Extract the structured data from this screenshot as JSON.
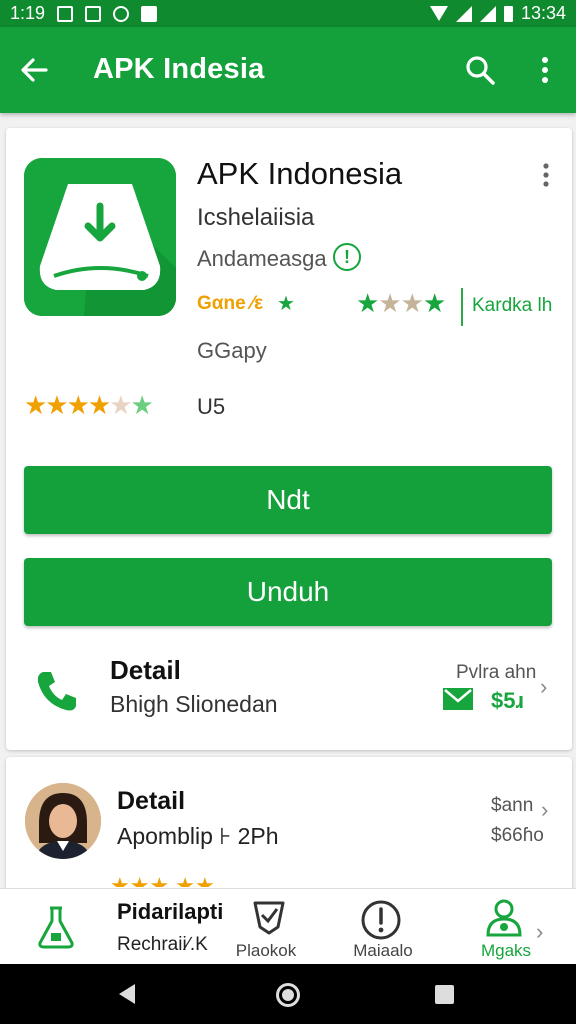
{
  "status_bar": {
    "time": "1:19",
    "clock_right": "13:34",
    "icons": [
      "image-icon",
      "mail-icon",
      "alarm-icon",
      "shield-icon",
      "wifi-icon",
      "signal-icon",
      "signal-icon",
      "battery-icon"
    ]
  },
  "app_bar": {
    "title": "APK Indesia",
    "back_icon": "back-arrow-icon",
    "search_icon": "search-icon",
    "more_icon": "more-vert-icon"
  },
  "app_card": {
    "name": "APK Indonesia",
    "subtitle": "Icshelaiisia",
    "developer": "Andameasga",
    "badge_label": "Gαne ⁄ε",
    "right_label": "Kardka lh",
    "category": "GGapy",
    "rating_count": "U5",
    "rating": 4.5,
    "primary_button": "Ndt",
    "secondary_button": "Unduh",
    "detail": {
      "title": "Detail",
      "subtitle": "Bhigh Slionedan",
      "right_label": "Pvlra ahn",
      "price": "$5ɹ"
    }
  },
  "second_card": {
    "title": "Detail",
    "subtitle": "Apomblip ⊦ 2Ph",
    "right_top": "$ann",
    "right_bottom": "$66ɦo"
  },
  "bottom_nav": {
    "item1_title": "Pidarilapti",
    "item1_sub": "Rechraii∕.K",
    "item2": "Plaokok",
    "item3": "Maiaalo",
    "item4": "Mgaks"
  },
  "colors": {
    "primary_green": "#14a03a",
    "dark_green": "#0f8a2e",
    "star_orange": "#f0a000"
  }
}
